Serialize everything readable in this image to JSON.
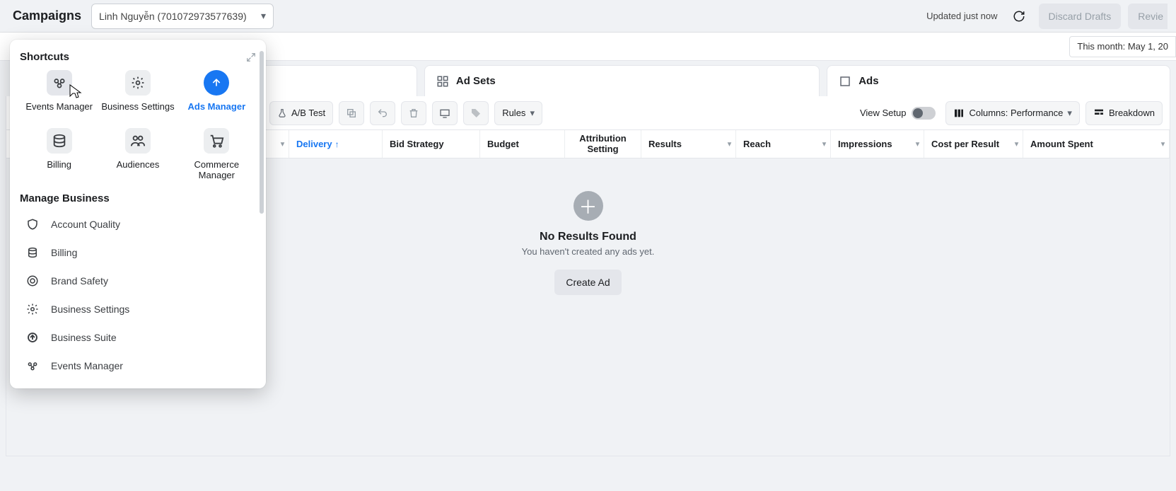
{
  "header": {
    "title": "Campaigns",
    "account_name": "Linh Nguyễn (701072973577639)",
    "updated_text": "Updated just now",
    "discard_label": "Discard Drafts",
    "review_label": "Revie"
  },
  "date_filter": "This month: May 1, 20",
  "tabs": {
    "adsets": "Ad Sets",
    "ads": "Ads"
  },
  "toolbar": {
    "abtest": "A/B Test",
    "rules": "Rules",
    "view_setup": "View Setup",
    "columns": "Columns: Performance",
    "breakdown": "Breakdown"
  },
  "columns": [
    "Delivery",
    "Bid Strategy",
    "Budget",
    "Attribution Setting",
    "Results",
    "Reach",
    "Impressions",
    "Cost per Result",
    "Amount Spent"
  ],
  "empty": {
    "title": "No Results Found",
    "sub": "You haven't created any ads yet.",
    "cta": "Create Ad"
  },
  "panel": {
    "shortcuts_title": "Shortcuts",
    "items": [
      "Events Manager",
      "Business Settings",
      "Ads Manager",
      "Billing",
      "Audiences",
      "Commerce Manager"
    ],
    "manage_title": "Manage Business",
    "manage_items": [
      "Account Quality",
      "Billing",
      "Brand Safety",
      "Business Settings",
      "Business Suite",
      "Events Manager"
    ]
  }
}
